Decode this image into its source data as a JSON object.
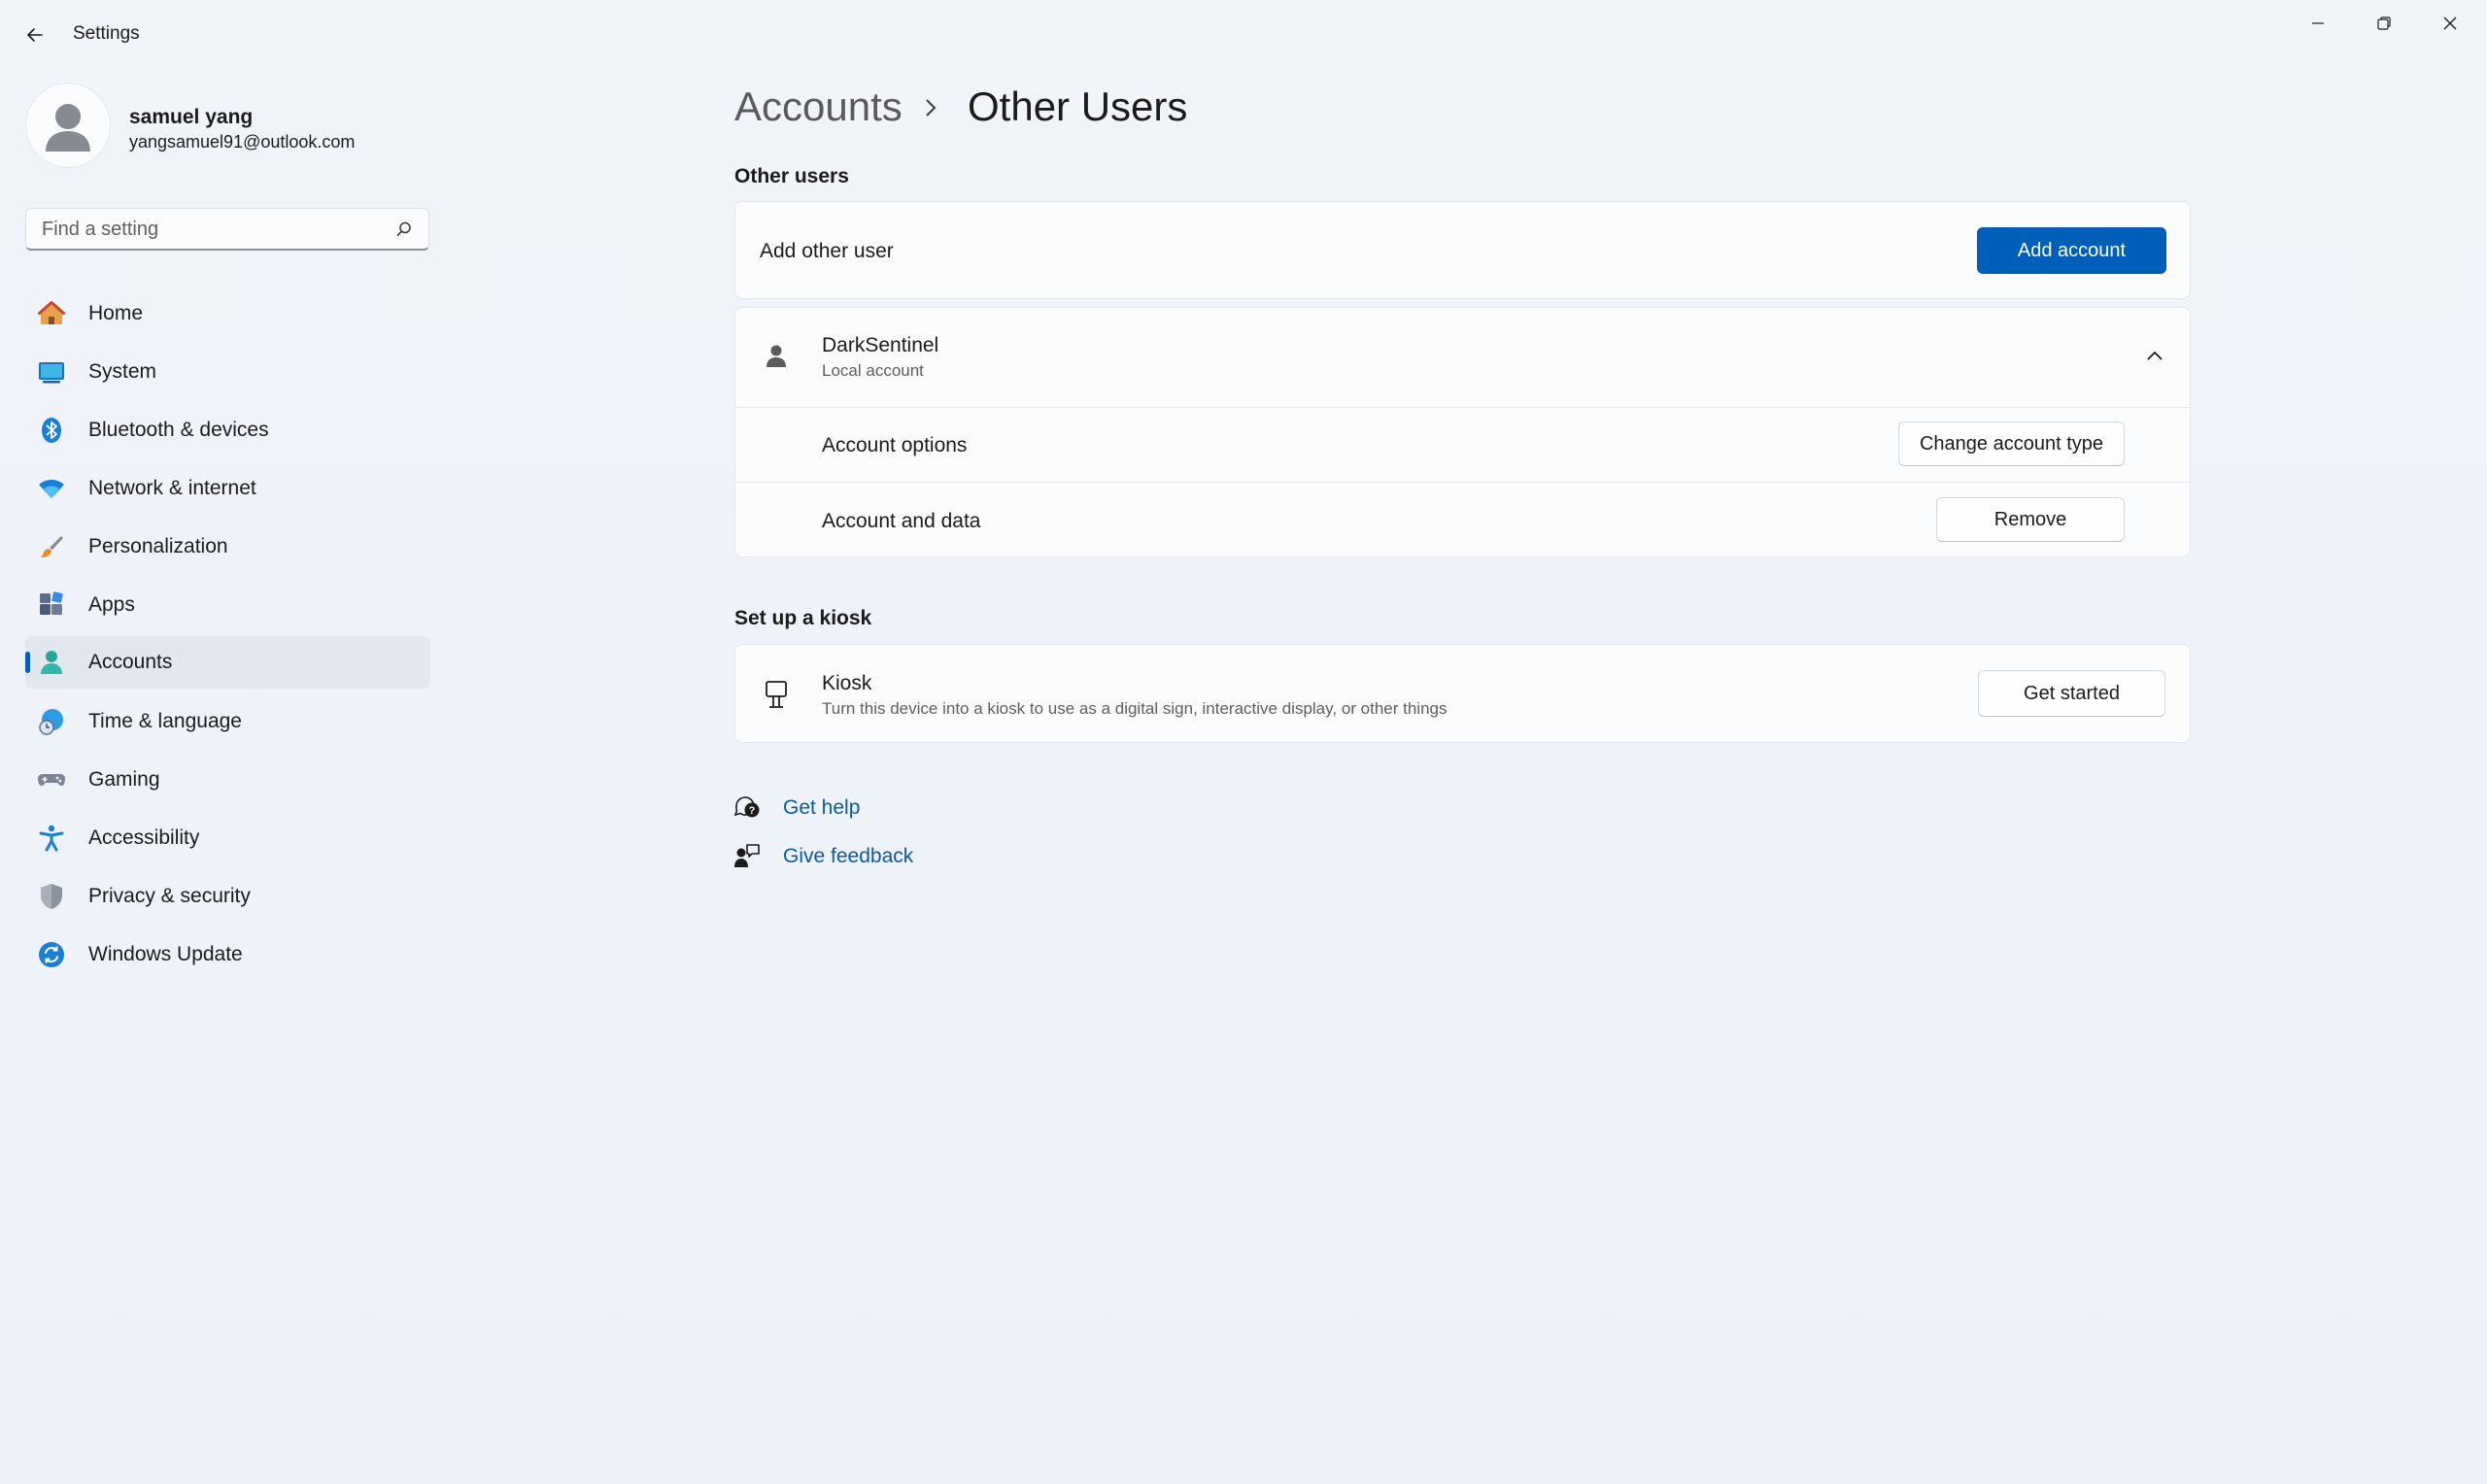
{
  "window": {
    "title": "Settings"
  },
  "profile": {
    "name": "samuel yang",
    "email": "yangsamuel91@outlook.com"
  },
  "search": {
    "placeholder": "Find a setting",
    "value": ""
  },
  "nav": {
    "items": [
      {
        "label": "Home",
        "icon": "home-icon"
      },
      {
        "label": "System",
        "icon": "system-icon"
      },
      {
        "label": "Bluetooth & devices",
        "icon": "bluetooth-icon"
      },
      {
        "label": "Network & internet",
        "icon": "wifi-icon"
      },
      {
        "label": "Personalization",
        "icon": "brush-icon"
      },
      {
        "label": "Apps",
        "icon": "apps-icon"
      },
      {
        "label": "Accounts",
        "icon": "accounts-icon",
        "selected": true
      },
      {
        "label": "Time & language",
        "icon": "time-language-icon"
      },
      {
        "label": "Gaming",
        "icon": "gamepad-icon"
      },
      {
        "label": "Accessibility",
        "icon": "accessibility-icon"
      },
      {
        "label": "Privacy & security",
        "icon": "shield-icon"
      },
      {
        "label": "Windows Update",
        "icon": "update-icon"
      }
    ]
  },
  "breadcrumb": {
    "parent": "Accounts",
    "current": "Other Users"
  },
  "other_users": {
    "section_title": "Other users",
    "add_row_label": "Add other user",
    "add_button": "Add account",
    "user": {
      "name": "DarkSentinel",
      "type": "Local account",
      "expanded": true,
      "options_label": "Account options",
      "options_button": "Change account type",
      "data_label": "Account and data",
      "data_button": "Remove"
    }
  },
  "kiosk": {
    "section_title": "Set up a kiosk",
    "title": "Kiosk",
    "description": "Turn this device into a kiosk to use as a digital sign, interactive display, or other things",
    "button": "Get started"
  },
  "links": {
    "help": "Get help",
    "feedback": "Give feedback"
  },
  "colors": {
    "accent": "#005fb8",
    "link": "#0a5aa6",
    "selected_nav_bg": "#e3e7ef"
  }
}
